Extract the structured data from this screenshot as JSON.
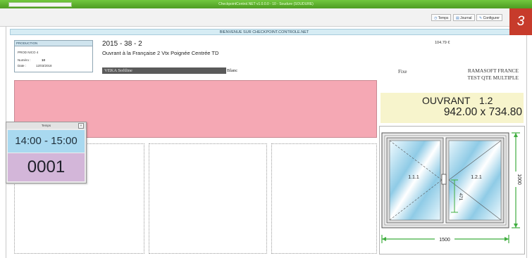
{
  "window": {
    "title": "CheckpointControl.NET v1.0.0.0 - 10 - Soudure (SOUDURE)"
  },
  "toolbar": {
    "temps_label": "Temps",
    "journal_label": "Journal",
    "configurer_label": "Configurer"
  },
  "header": {
    "welcome": "BIENVENUE SUR CHECKPOINT.CONTROLE.NET"
  },
  "production": {
    "title": "PRODUCTION",
    "line_name": "PROD NICO 4",
    "numero_label": "Numéro :",
    "numero_value": "10",
    "date_label": "Date :",
    "date_value": "12/03/2018"
  },
  "order": {
    "number": "2015 - 38 - 2",
    "description": "Ouvrant à la Française 2 Vtx Poignée Centrée TD",
    "profile": "VEKA Softline",
    "color": "Blanc",
    "price": "104.79 €",
    "type": "Fixe",
    "company": "RAMASOFT FRANCE",
    "test_label": "TEST QTE MULTIPLE"
  },
  "ouvrant": {
    "label": "OUVRANT",
    "number": "1.2",
    "dimensions": "942.00 x 734.80"
  },
  "drawing": {
    "left_sash": "1.1.1",
    "right_sash": "1.2.1",
    "height_dim": "1000",
    "width_dim": "1500",
    "handle_dim": "471"
  },
  "temps_window": {
    "title": "Temps",
    "close": "×",
    "time_range": "14:00 - 15:00",
    "counter": "0001"
  },
  "badge": {
    "number": "3"
  },
  "colors": {
    "titlebar": "#5aa92c",
    "pink_panel": "#f5a8b4",
    "ouvrant_bg": "#f7f4cc",
    "time_bg": "#a9d9f0",
    "counter_bg": "#d3b6d9",
    "dimension_lines": "#3fae3f",
    "badge": "#c73b2b"
  }
}
